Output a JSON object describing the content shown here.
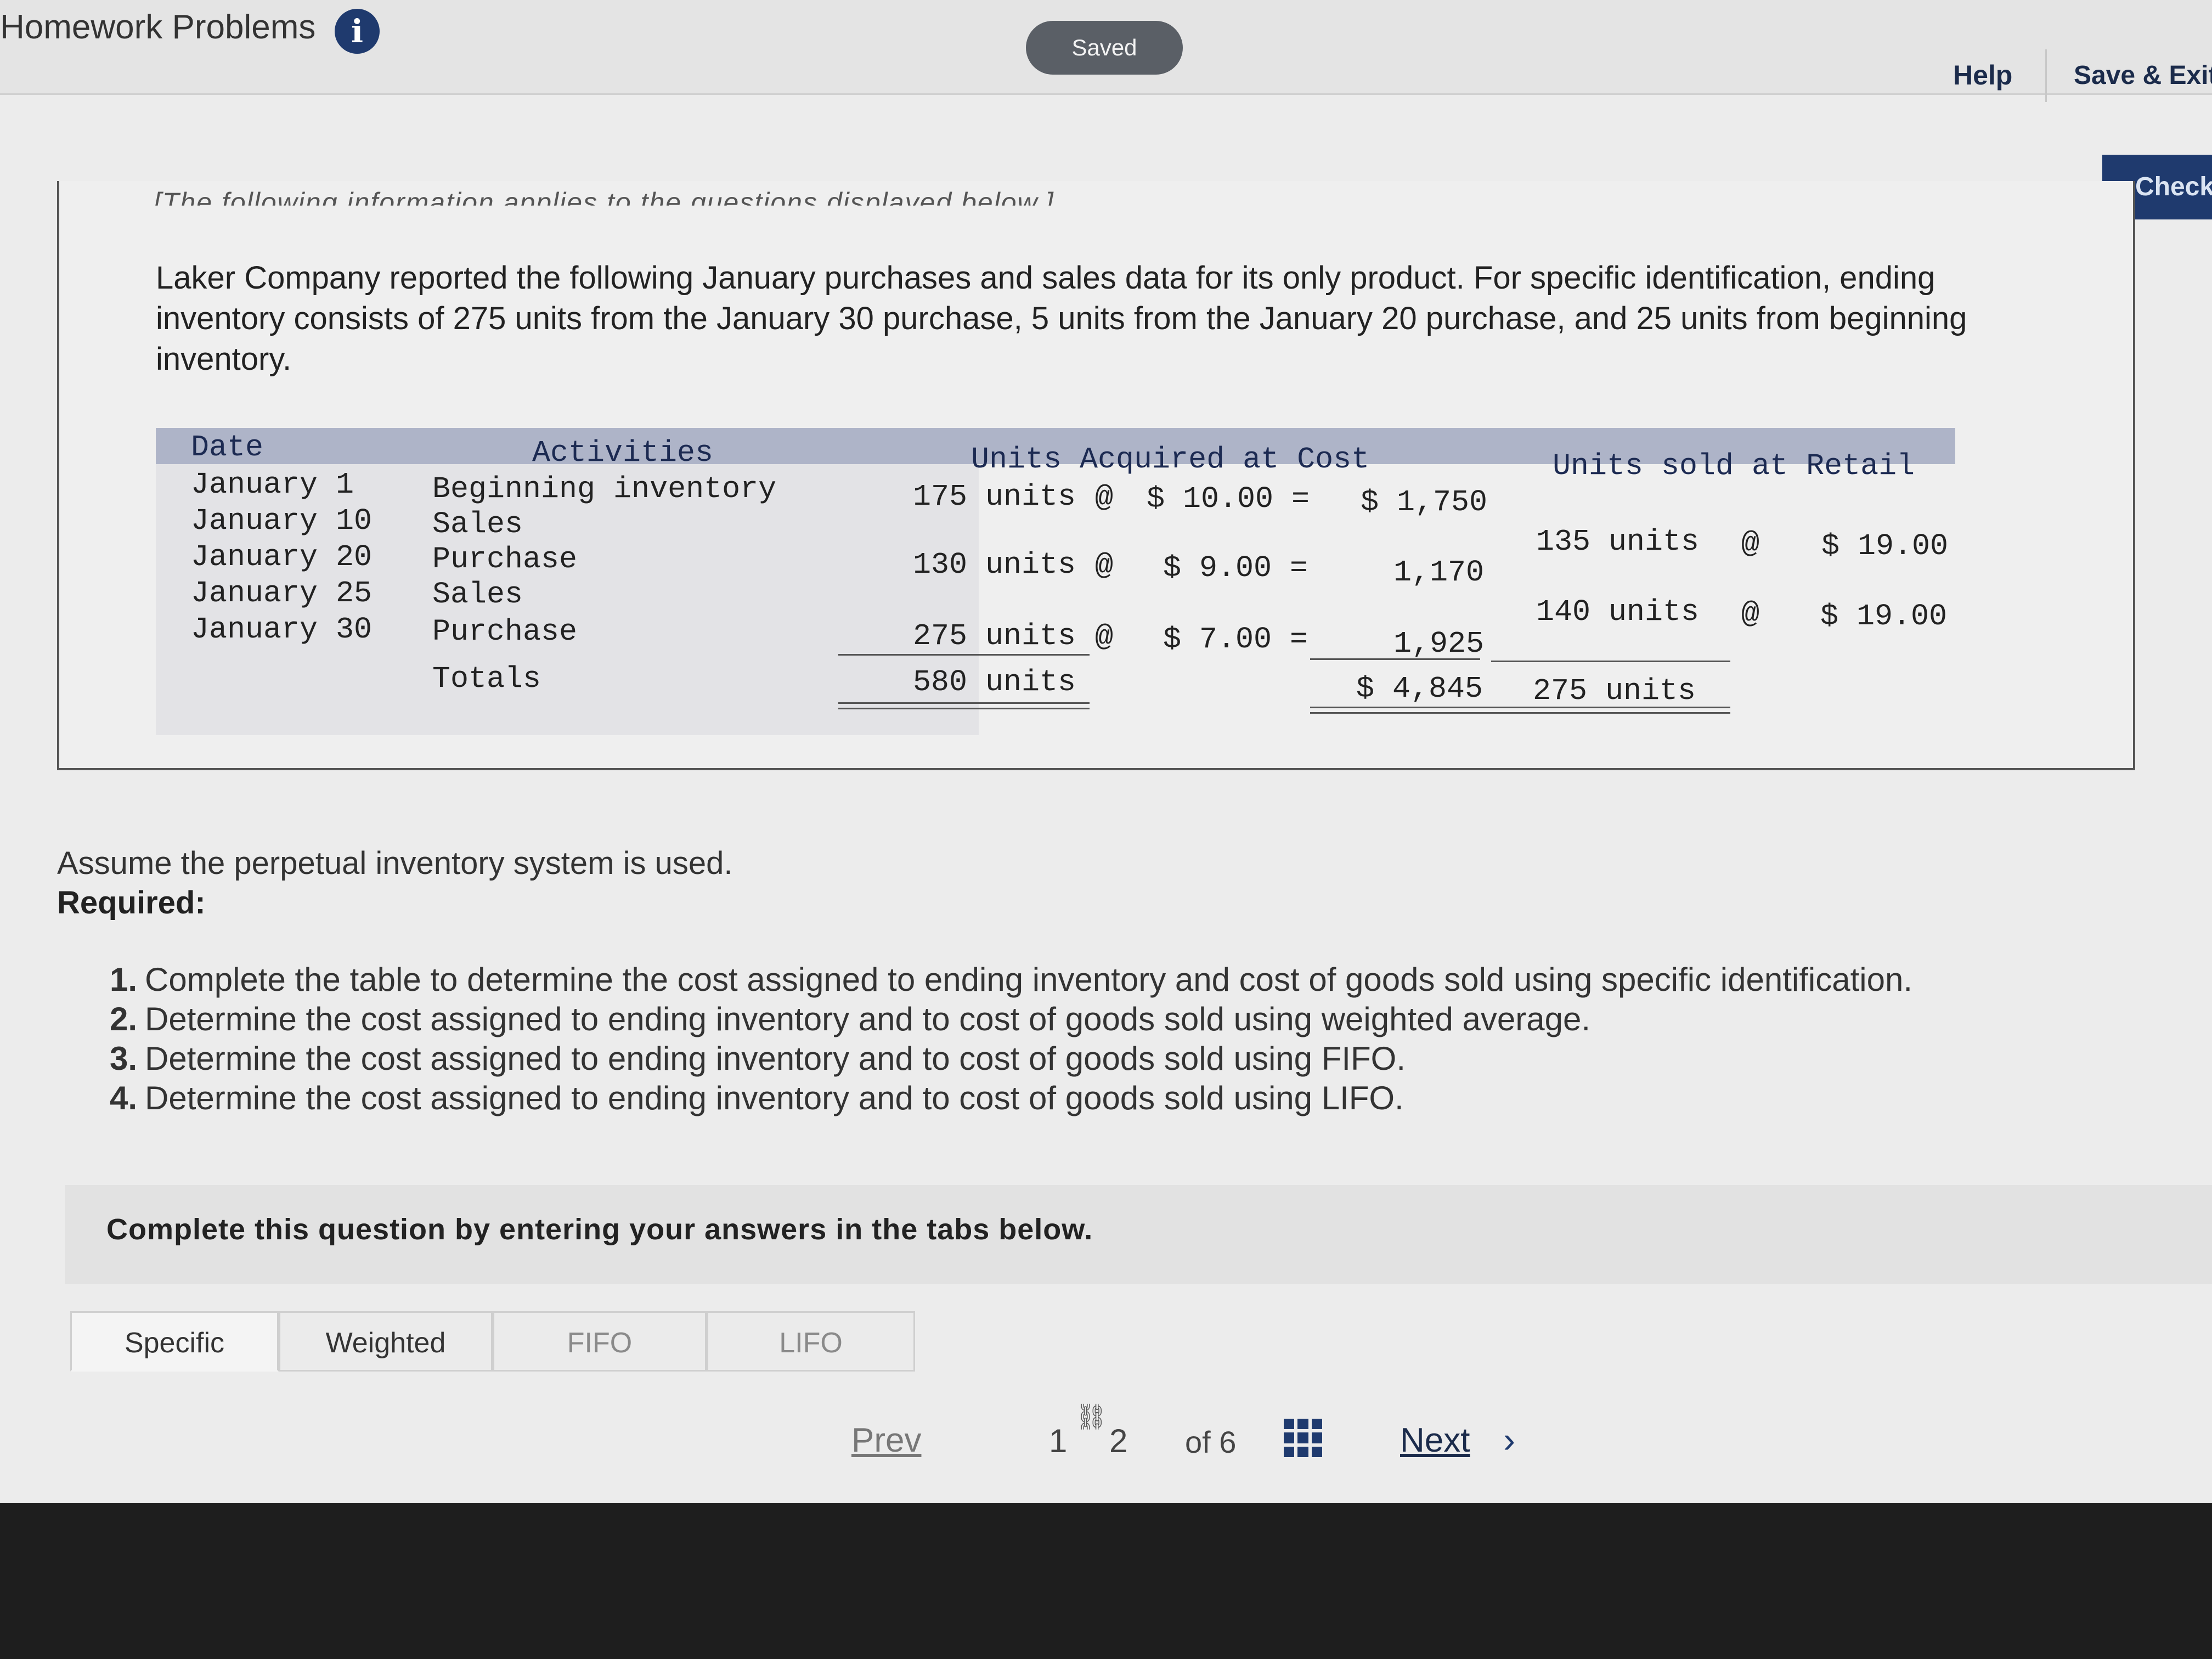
{
  "header": {
    "title": "Homework Problems",
    "saved_label": "Saved",
    "help_label": "Help",
    "save_exit_label": "Save & Exit",
    "check_label": "Check"
  },
  "info": {
    "cut_line": "[The following information applies to the questions displayed below.]",
    "intro": "Laker Company reported the following January purchases and sales data for its only product. For specific identification, ending inventory consists of 275 units from the January 30 purchase, 5 units from the January 20 purchase, and 25 units from beginning inventory."
  },
  "table": {
    "headers": {
      "date": "Date",
      "activities": "Activities",
      "acquired": "Units Acquired at Cost",
      "sold": "Units sold at Retail"
    },
    "rows": [
      {
        "date": "January 1",
        "activity": "Beginning inventory",
        "acq_units": "175 units",
        "at1": "@",
        "acq_cost": "$ 10.00 =",
        "acq_total": "$ 1,750",
        "sold_units": "",
        "at2": "",
        "sold_price": ""
      },
      {
        "date": "January 10",
        "activity": "Sales",
        "acq_units": "",
        "at1": "",
        "acq_cost": "",
        "acq_total": "",
        "sold_units": "135 units",
        "at2": "@",
        "sold_price": "$ 19.00"
      },
      {
        "date": "January 20",
        "activity": "Purchase",
        "acq_units": "130 units",
        "at1": "@",
        "acq_cost": "$ 9.00 =",
        "acq_total": "1,170",
        "sold_units": "",
        "at2": "",
        "sold_price": ""
      },
      {
        "date": "January 25",
        "activity": "Sales",
        "acq_units": "",
        "at1": "",
        "acq_cost": "",
        "acq_total": "",
        "sold_units": "140 units",
        "at2": "@",
        "sold_price": "$ 19.00"
      },
      {
        "date": "January 30",
        "activity": "Purchase",
        "acq_units": "275 units",
        "at1": "@",
        "acq_cost": "$ 7.00 =",
        "acq_total": "1,925",
        "sold_units": "",
        "at2": "",
        "sold_price": ""
      }
    ],
    "totals": {
      "label": "Totals",
      "acq_units": "580 units",
      "acq_total": "$ 4,845",
      "sold_units": "275 units"
    }
  },
  "questions": {
    "assume": "Assume the perpetual inventory system is used.",
    "required_label": "Required:",
    "items": [
      {
        "num": "1.",
        "text": "Complete the table to determine the cost assigned to ending inventory and cost of goods sold using specific identification."
      },
      {
        "num": "2.",
        "text": "Determine the cost assigned to ending inventory and to cost of goods sold using weighted average."
      },
      {
        "num": "3.",
        "text": "Determine the cost assigned to ending inventory and to cost of goods sold using FIFO."
      },
      {
        "num": "4.",
        "text": "Determine the cost assigned to ending inventory and to cost of goods sold using LIFO."
      }
    ],
    "complete_prompt": "Complete this question by entering your answers in the tabs below."
  },
  "tabs": [
    {
      "label": "Specific"
    },
    {
      "label": "Weighted"
    },
    {
      "label": "FIFO"
    },
    {
      "label": "LIFO"
    }
  ],
  "pagination": {
    "prev_label": "Prev",
    "pages": [
      "1",
      "2"
    ],
    "of_label": "of 6",
    "next_label": "Next"
  },
  "colors": {
    "brand": "#1f3a6e",
    "table_header": "#aeb4c8"
  }
}
